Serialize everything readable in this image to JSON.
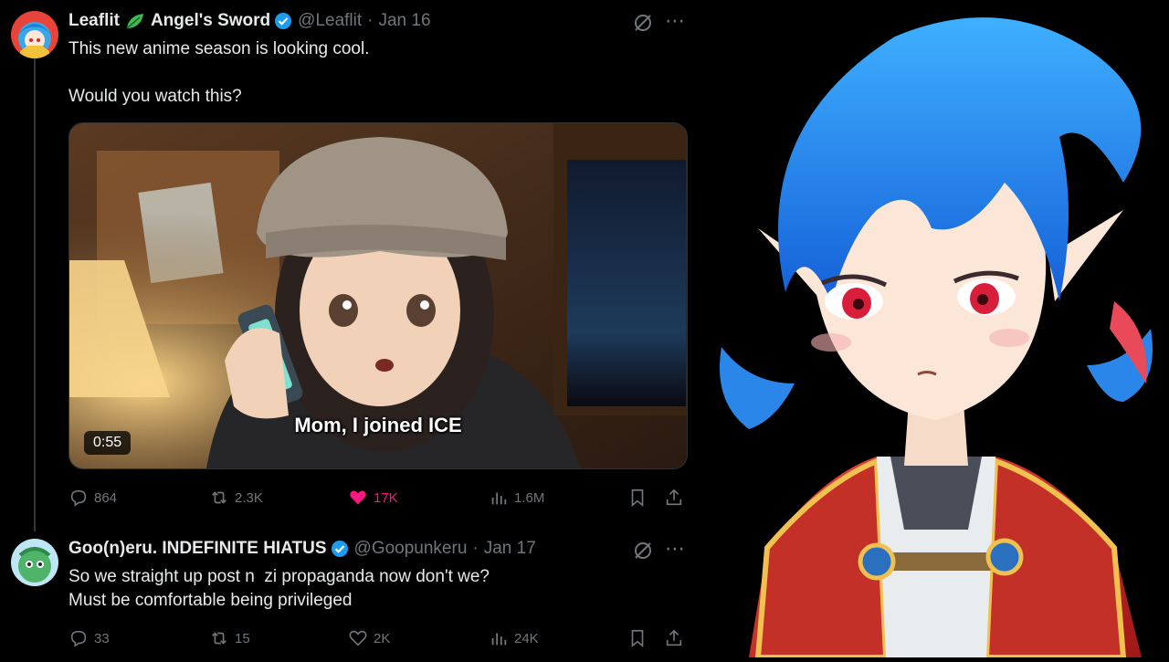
{
  "colors": {
    "background": "#000000",
    "text": "#e7e9ea",
    "muted": "#71767b",
    "like": "#f91880",
    "verified": "#1d9bf0"
  },
  "tweets": [
    {
      "name": "Leaflit",
      "name_suffix": "Angel's Sword",
      "handle": "@Leaflit",
      "separator": "·",
      "date": "Jan 16",
      "more": "⋯",
      "text": "This new anime season is looking cool.\n\nWould you watch this?",
      "media": {
        "caption": "Mom, I joined ICE",
        "duration": "0:55"
      },
      "replies": "864",
      "reposts": "2.3K",
      "likes": "17K",
      "views": "1.6M",
      "liked": true
    },
    {
      "name": "Goo(n)eru. INDEFINITE HIATUS",
      "handle": "@Goopunkeru",
      "separator": "·",
      "date": "Jan 17",
      "more": "⋯",
      "text": "So we straight up post n  zi propaganda now don't we?\nMust be comfortable being privileged",
      "replies": "33",
      "reposts": "15",
      "likes": "2K",
      "views": "24K",
      "liked": false
    }
  ],
  "icons": [
    "reply-icon",
    "repost-icon",
    "like-icon",
    "views-icon",
    "bookmark-icon",
    "share-icon",
    "grok-icon",
    "verified-icon",
    "leaf-icon"
  ]
}
